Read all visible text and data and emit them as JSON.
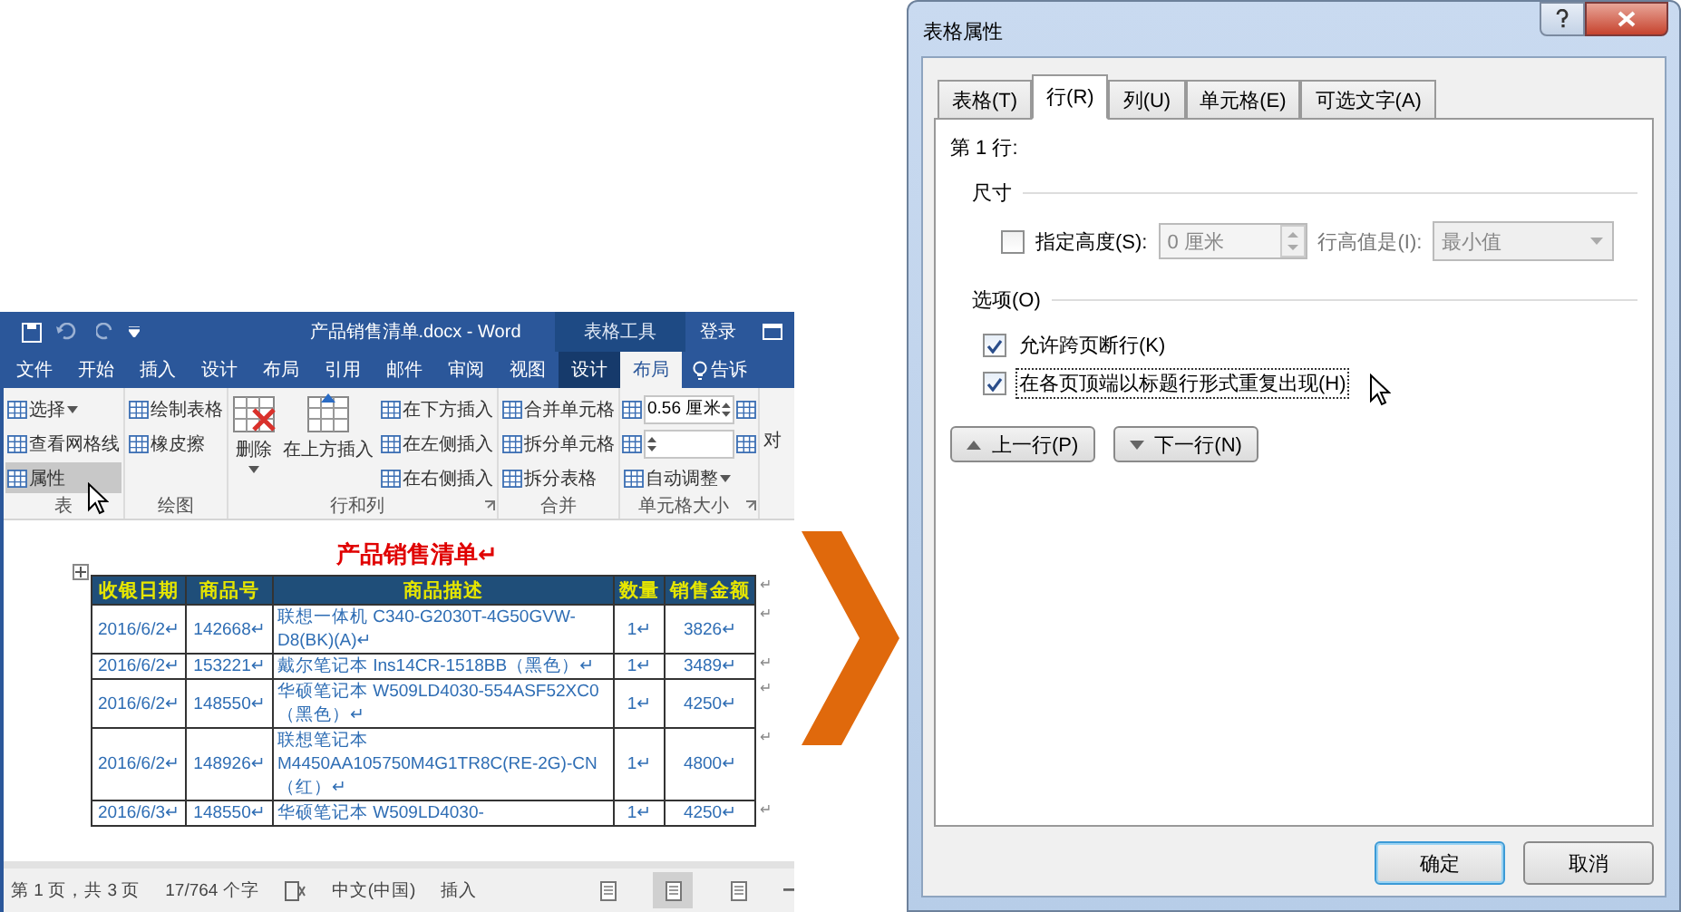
{
  "word": {
    "title": "产品销售清单.docx - Word",
    "context_label": "表格工具",
    "sign_in": "登录",
    "tabs": [
      {
        "label": "文件",
        "selected": false,
        "contextual": false
      },
      {
        "label": "开始",
        "selected": false,
        "contextual": false
      },
      {
        "label": "插入",
        "selected": false,
        "contextual": false
      },
      {
        "label": "设计",
        "selected": false,
        "contextual": false
      },
      {
        "label": "布局",
        "selected": false,
        "contextual": false
      },
      {
        "label": "引用",
        "selected": false,
        "contextual": false
      },
      {
        "label": "邮件",
        "selected": false,
        "contextual": false
      },
      {
        "label": "审阅",
        "selected": false,
        "contextual": false
      },
      {
        "label": "视图",
        "selected": false,
        "contextual": false
      },
      {
        "label": "设计",
        "selected": false,
        "contextual": true
      },
      {
        "label": "布局",
        "selected": true,
        "contextual": true
      }
    ],
    "tell_me": "告诉",
    "ribbon_groups": [
      {
        "label": "表",
        "columns": [
          [
            {
              "kind": "small",
              "label": "选择",
              "dropdown": true,
              "hovered": false
            },
            {
              "kind": "small",
              "label": "查看网格线",
              "dropdown": false,
              "hovered": false
            },
            {
              "kind": "small",
              "label": "属性",
              "dropdown": false,
              "hovered": true
            }
          ]
        ]
      },
      {
        "label": "绘图",
        "columns": [
          [
            {
              "kind": "small",
              "label": "绘制表格",
              "dropdown": false,
              "hovered": false
            },
            {
              "kind": "small",
              "label": "橡皮擦",
              "dropdown": false,
              "hovered": false
            }
          ]
        ]
      },
      {
        "label": "行和列",
        "launcher": true,
        "columns": [
          [
            {
              "kind": "large",
              "label": "删除",
              "dropdown": true,
              "hovered": false
            }
          ],
          [
            {
              "kind": "large",
              "label": "在上方插入",
              "dropdown": false,
              "hovered": false
            }
          ],
          [
            {
              "kind": "small",
              "label": "在下方插入",
              "dropdown": false,
              "hovered": false
            },
            {
              "kind": "small",
              "label": "在左侧插入",
              "dropdown": false,
              "hovered": false
            },
            {
              "kind": "small",
              "label": "在右侧插入",
              "dropdown": false,
              "hovered": false
            }
          ]
        ]
      },
      {
        "label": "合并",
        "columns": [
          [
            {
              "kind": "small",
              "label": "合并单元格",
              "dropdown": false,
              "hovered": false
            },
            {
              "kind": "small",
              "label": "拆分单元格",
              "dropdown": false,
              "hovered": false
            },
            {
              "kind": "small",
              "label": "拆分表格",
              "dropdown": false,
              "hovered": false
            }
          ]
        ]
      },
      {
        "label": "单元格大小",
        "launcher": true,
        "columns": [
          [
            {
              "kind": "field",
              "value": "0.56 厘米"
            },
            {
              "kind": "field"
            },
            {
              "kind": "small",
              "label": "自动调整",
              "dropdown": true,
              "hovered": false
            }
          ]
        ]
      }
    ],
    "ribbon_cut_text": "对",
    "doc_title": "产品销售清单↵",
    "columns": [
      "收银日期",
      "商品号",
      "商品描述",
      "数量",
      "销售金额"
    ],
    "header_mark": "↵",
    "rows": [
      {
        "cells": [
          "2016/6/2↵",
          "142668↵",
          "联想一体机 C340-G2030T-4G50GVW-D8(BK)(A)↵",
          "1↵",
          "3826↵"
        ],
        "mark": "↵"
      },
      {
        "cells": [
          "2016/6/2↵",
          "153221↵",
          "戴尔笔记本 Ins14CR-1518BB（黑色）↵",
          "1↵",
          "3489↵"
        ],
        "mark": "↵"
      },
      {
        "cells": [
          "2016/6/2↵",
          "148550↵",
          "华硕笔记本 W509LD4030-554ASF52XC0（黑色）↵",
          "1↵",
          "4250↵"
        ],
        "mark": "↵"
      },
      {
        "cells": [
          "2016/6/2↵",
          "148926↵",
          "联想笔记本 M4450AA105750M4G1TR8C(RE-2G)-CN（红）↵",
          "1↵",
          "4800↵"
        ],
        "mark": "↵"
      },
      {
        "cells": [
          "2016/6/3↵",
          "148550↵",
          "华硕笔记本 W509LD4030-",
          "1↵",
          "4250↵"
        ],
        "mark": "↵"
      }
    ],
    "status": {
      "page": "第 1 页，共 3 页",
      "words": "17/764 个字",
      "language": "中文(中国)",
      "mode": "插入",
      "view_buttons": [
        {
          "selected": false
        },
        {
          "selected": true
        },
        {
          "selected": false
        }
      ]
    }
  },
  "dialog": {
    "title": "表格属性",
    "tabs": [
      {
        "label": "表格(T)",
        "selected": false
      },
      {
        "label": "行(R)",
        "selected": true
      },
      {
        "label": "列(U)",
        "selected": false
      },
      {
        "label": "单元格(E)",
        "selected": false
      },
      {
        "label": "可选文字(A)",
        "selected": false
      }
    ],
    "row_label": "第 1 行:",
    "size_heading": "尺寸",
    "height_check": {
      "label": "指定高度(S):",
      "checked": false
    },
    "height_value": "0 厘米",
    "height_disabled": true,
    "rule_label": "行高值是(I):",
    "rule_value": "最小值",
    "options_heading": "选项(O)",
    "options": [
      {
        "label": "允许跨页断行(K)",
        "checked": true,
        "focused": false
      },
      {
        "label": "在各页顶端以标题行形式重复出现(H)",
        "checked": true,
        "focused": true
      }
    ],
    "nav_buttons": [
      {
        "label": "上一行(P)",
        "kind": "up"
      },
      {
        "label": "下一行(N)",
        "kind": "down"
      }
    ],
    "buttons": [
      {
        "label": "确定",
        "default": true
      },
      {
        "label": "取消",
        "default": false
      }
    ]
  }
}
